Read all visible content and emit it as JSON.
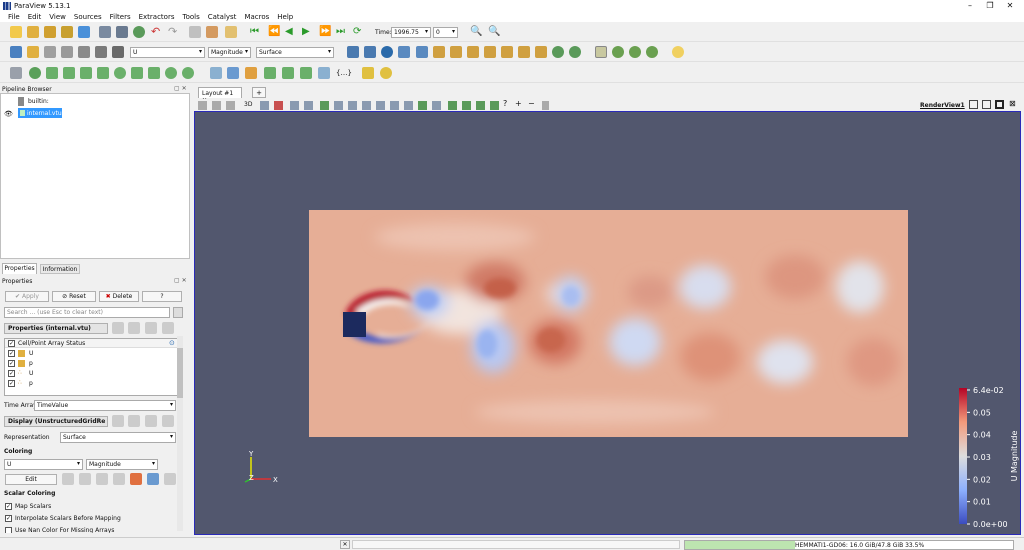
{
  "app": {
    "title": "ParaView 5.13.1"
  },
  "menu": [
    "File",
    "Edit",
    "View",
    "Sources",
    "Filters",
    "Extractors",
    "Tools",
    "Catalyst",
    "Macros",
    "Help"
  ],
  "toolbar": {
    "time_label": "Time:",
    "time_value": "1996.75",
    "time_step": "0",
    "array": "U",
    "component": "Magnitude",
    "representation": "Surface"
  },
  "pipeline": {
    "title": "Pipeline Browser",
    "items": [
      "builtin:",
      "internal.vtu"
    ]
  },
  "tabs": {
    "properties": "Properties",
    "information": "Information"
  },
  "properties": {
    "title": "Properties",
    "apply": "Apply",
    "reset": "Reset",
    "delete": "Delete",
    "help": "?",
    "search_placeholder": "Search ... (use Esc to clear text)",
    "section_properties": "Properties (internal.vtu)",
    "array_status_header": "Cell/Point Array Status",
    "arrays": [
      "U",
      "p",
      "U",
      "p"
    ],
    "time_array_label": "Time Array",
    "time_array_value": "TimeValue",
    "section_display": "Display (UnstructuredGridRe",
    "representation_label": "Representation",
    "representation_value": "Surface",
    "coloring_label": "Coloring",
    "coloring_array": "U",
    "coloring_component": "Magnitude",
    "edit": "Edit",
    "scalar_coloring_label": "Scalar Coloring",
    "map_scalars": "Map Scalars",
    "interpolate": "Interpolate Scalars Before Mapping",
    "nan_color": "Use Nan Color For Missing Arrays"
  },
  "layout": {
    "tab": "Layout #1",
    "add": "+",
    "view_name": "RenderView1",
    "threed": "3D"
  },
  "colorbar": {
    "title": "U Magnitude",
    "ticks": [
      "6.4e-02",
      "0.05",
      "0.04",
      "0.03",
      "0.02",
      "0.01",
      "0.0e+00"
    ]
  },
  "axes": {
    "x": "X",
    "y": "Y",
    "z": "Z"
  },
  "status": {
    "memory": "HEMMATI1-GD06: 16.0 GiB/47.8 GiB 33.5%",
    "memory_fraction": 0.335
  },
  "colors": {
    "view_bg": "#52576e",
    "field_base": "#e6ae96",
    "obstacle": "#1c2a5e",
    "low": "#3b4cc0",
    "high": "#b40426"
  }
}
